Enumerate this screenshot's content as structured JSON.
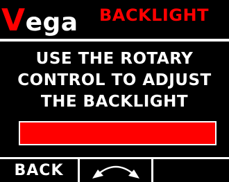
{
  "header": {
    "brand_initial": "V",
    "brand_rest": "ega",
    "screen_title": "BACKLIGHT"
  },
  "instructions": {
    "line_1": "USE THE ROTARY",
    "line_2": "CONTROL TO ADJUST",
    "line_3": "THE BACKLIGHT"
  },
  "backlight": {
    "level_fraction": 1.0
  },
  "softkeys": {
    "key_1_label": "BACK",
    "key_2_icon": "rotary-arrows-icon",
    "key_3_label": ""
  },
  "colors": {
    "accent": "#ff0000",
    "foreground": "#ffffff",
    "background": "#000000"
  }
}
